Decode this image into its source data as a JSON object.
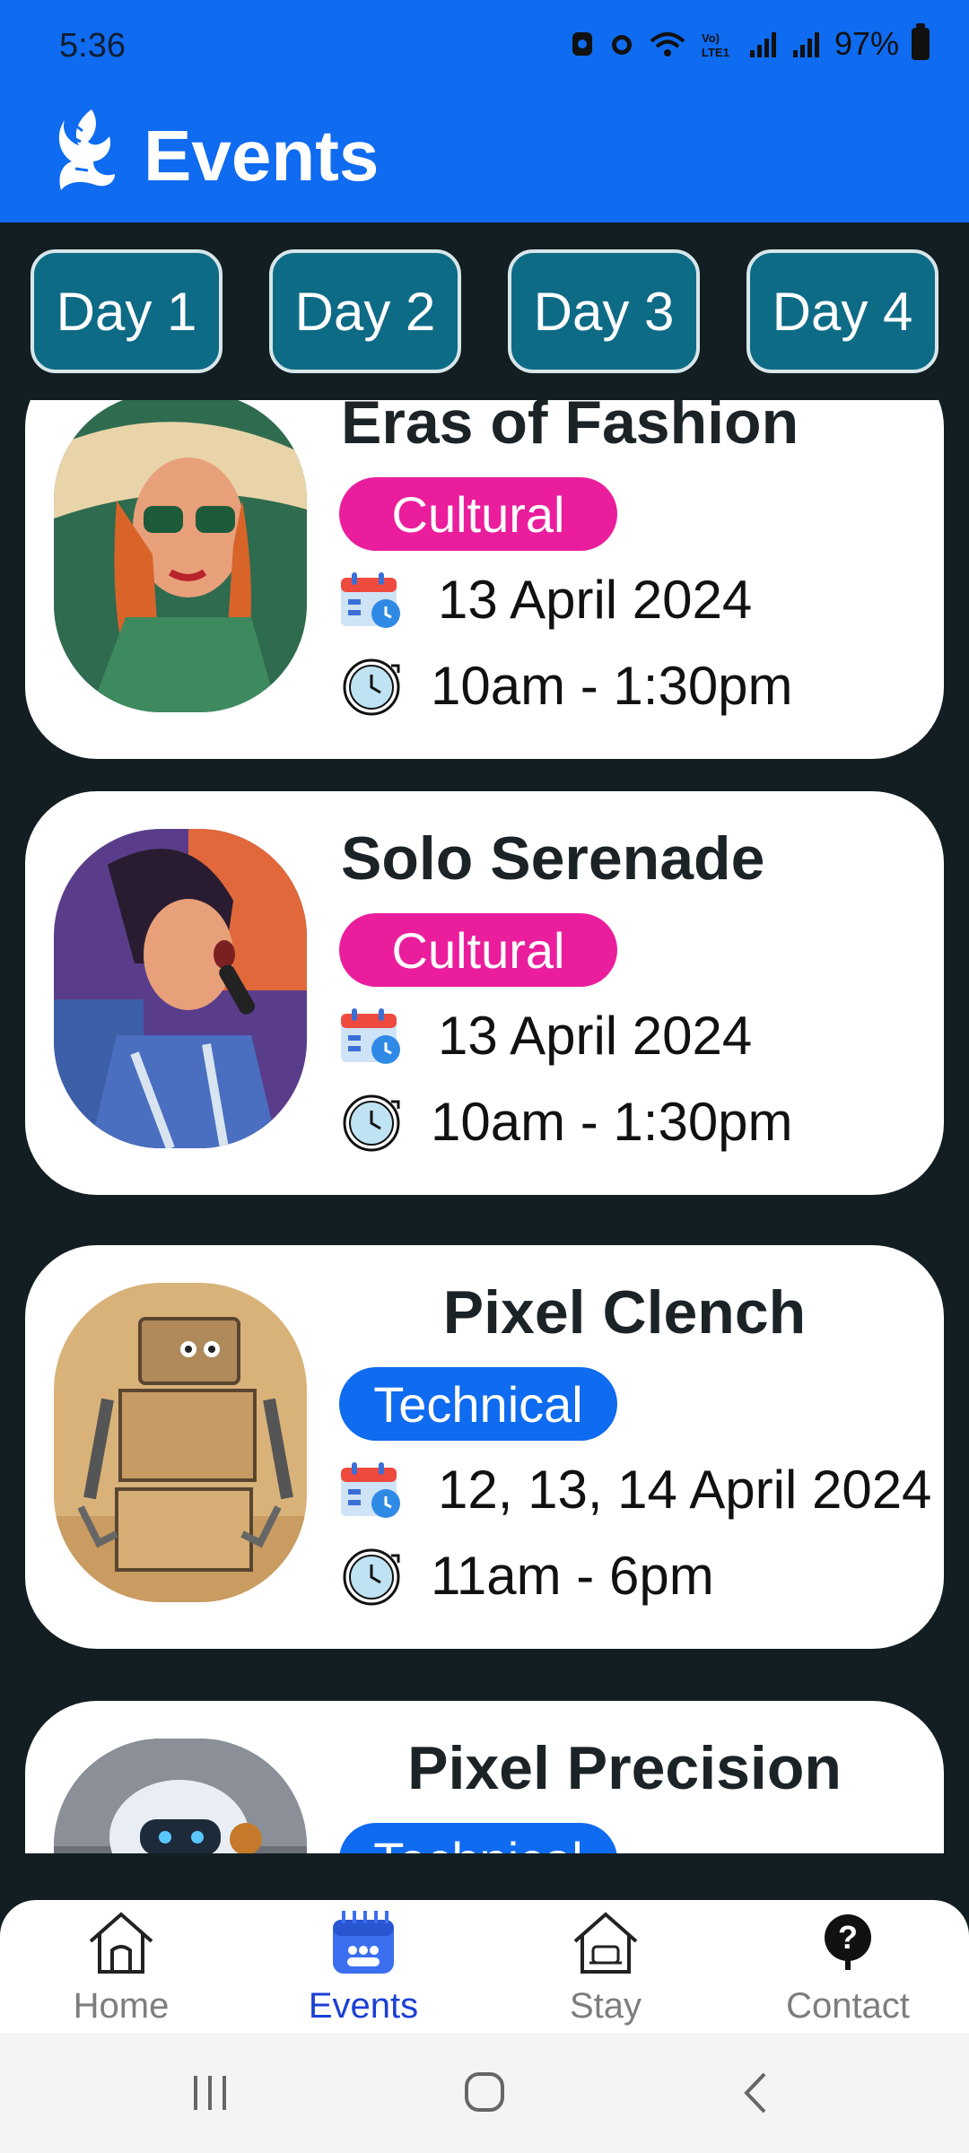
{
  "status_bar": {
    "time": "5:36",
    "battery": "97%"
  },
  "header": {
    "title": "Events",
    "logo_icon": "phoenix-logo"
  },
  "tabs": [
    {
      "label": "Day 1"
    },
    {
      "label": "Day 2"
    },
    {
      "label": "Day 3"
    },
    {
      "label": "Day 4"
    }
  ],
  "events": [
    {
      "title": "Eras of Fashion",
      "category": "Cultural",
      "date": "13 April 2024",
      "time": "10am - 1:30pm"
    },
    {
      "title": "Solo Serenade",
      "category": "Cultural",
      "date": "13 April 2024",
      "time": "10am - 1:30pm"
    },
    {
      "title": "Pixel Clench",
      "category": "Technical",
      "date": "12, 13, 14 April 2024",
      "time": "11am - 6pm"
    },
    {
      "title": "Pixel Precision",
      "category": "Technical",
      "date": "",
      "time": ""
    }
  ],
  "colors": {
    "header": "#0f6bf0",
    "cultural": "#ea1e9c",
    "technical": "#0f6bf0",
    "tab": "#0e6b86",
    "active_nav": "#1b3fd6"
  },
  "bottom_nav": [
    {
      "label": "Home",
      "icon": "home-icon"
    },
    {
      "label": "Events",
      "icon": "events-icon"
    },
    {
      "label": "Stay",
      "icon": "stay-icon"
    },
    {
      "label": "Contact",
      "icon": "help-icon"
    }
  ]
}
